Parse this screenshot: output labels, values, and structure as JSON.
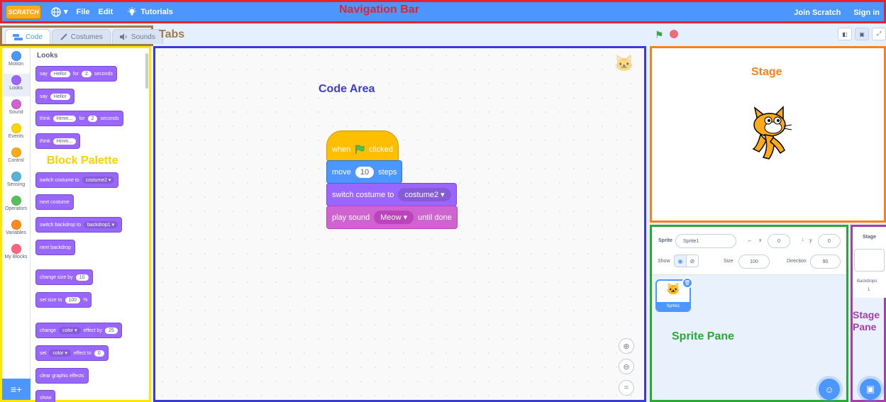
{
  "colors": {
    "navbar": "#4c97ff",
    "motion": "#4c97ff",
    "looks": "#9966ff",
    "sound": "#cf63cf",
    "events": "#ffbf00",
    "control": "#ffab19",
    "sensing": "#5cb1d6",
    "operators": "#59c059",
    "variables": "#ff8c1a",
    "myblocks": "#ff6680"
  },
  "nav": {
    "logo": "SCRATCH",
    "globe": "▾",
    "file": "File",
    "edit": "Edit",
    "tutorials": "Tutorials",
    "join": "Join Scratch",
    "signin": "Sign in",
    "annotation": "Navigation Bar"
  },
  "tabs": {
    "code": "Code",
    "costumes": "Costumes",
    "sounds": "Sounds",
    "annotation": "Tabs"
  },
  "categories": [
    {
      "label": "Motion",
      "color": "#4c97ff"
    },
    {
      "label": "Looks",
      "color": "#9966ff"
    },
    {
      "label": "Sound",
      "color": "#cf63cf"
    },
    {
      "label": "Events",
      "color": "#ffd500"
    },
    {
      "label": "Control",
      "color": "#ffab19"
    },
    {
      "label": "Sensing",
      "color": "#5cb1d6"
    },
    {
      "label": "Operators",
      "color": "#59c059"
    },
    {
      "label": "Variables",
      "color": "#ff8c1a"
    },
    {
      "label": "My Blocks",
      "color": "#ff6680"
    }
  ],
  "palette": {
    "heading": "Looks",
    "annotation": "Block Palette",
    "say_for": {
      "say": "say",
      "text": "Hello!",
      "for": "for",
      "num": "2",
      "seconds": "seconds"
    },
    "say": {
      "say": "say",
      "text": "Hello!"
    },
    "think_for": {
      "think": "think",
      "text": "Hmm...",
      "for": "for",
      "num": "2",
      "seconds": "seconds"
    },
    "think": {
      "think": "think",
      "text": "Hmm..."
    },
    "switch_costume": {
      "label": "switch costume to",
      "value": "costume2 ▾"
    },
    "next_costume": "next costume",
    "switch_backdrop": {
      "label": "switch backdrop to",
      "value": "backdrop1 ▾"
    },
    "next_backdrop": "next backdrop",
    "change_size": {
      "label": "change size by",
      "num": "10"
    },
    "set_size": {
      "label": "set size to",
      "num": "100",
      "unit": "%"
    },
    "change_effect": {
      "change": "change",
      "effect": "color ▾",
      "by": "effect by",
      "num": "25"
    },
    "set_effect": {
      "set": "set",
      "effect": "color ▾",
      "to": "effect to",
      "num": "0"
    },
    "clear": "clear graphic effects",
    "show": "show"
  },
  "code": {
    "annotation": "Code Area",
    "hat": {
      "when": "when",
      "clicked": "clicked"
    },
    "move": {
      "move": "move",
      "num": "10",
      "steps": "steps"
    },
    "switch_costume": {
      "label": "switch costume to",
      "value": "costume2 ▾"
    },
    "play_sound": {
      "label": "play sound",
      "value": "Meow ▾",
      "suffix": "until done"
    }
  },
  "stage": {
    "annotation": "Stage"
  },
  "sprite": {
    "annotation": "Sprite Pane",
    "sprite_label": "Sprite",
    "sprite_name": "Sprite1",
    "x_label": "x",
    "x_value": "0",
    "y_label": "y",
    "y_value": "0",
    "show_label": "Show",
    "size_label": "Size",
    "size_value": "100",
    "direction_label": "Direction",
    "direction_value": "90",
    "thumb_name": "Sprite1"
  },
  "stage_pane": {
    "title": "Stage",
    "backdrops_label": "Backdrops",
    "backdrops_count": "1",
    "annotation": "Stage Pane"
  }
}
